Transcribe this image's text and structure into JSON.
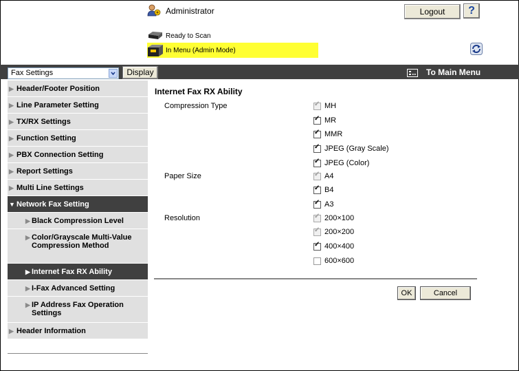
{
  "header": {
    "user": "Administrator",
    "logout_label": "Logout",
    "help_label": "?",
    "status_ready": "Ready to Scan",
    "status_mode": "In Menu (Admin Mode)"
  },
  "toolbar": {
    "category_select": "Fax Settings",
    "display_label": "Display",
    "to_main_menu": "To Main Menu"
  },
  "sidebar": {
    "items": [
      {
        "label": "Header/Footer Position"
      },
      {
        "label": "Line Parameter Setting"
      },
      {
        "label": "TX/RX Settings"
      },
      {
        "label": "Function Setting"
      },
      {
        "label": "PBX Connection Setting"
      },
      {
        "label": "Report Settings"
      },
      {
        "label": "Multi Line Settings"
      },
      {
        "label": "Network Fax Setting",
        "expanded": true
      },
      {
        "label": "Black Compression Level",
        "sub": true
      },
      {
        "label": "Color/Grayscale Multi-Value Compression Method",
        "sub": true
      },
      {
        "label": "Internet Fax RX Ability",
        "sub": true,
        "active": true
      },
      {
        "label": "I-Fax Advanced Setting",
        "sub": true
      },
      {
        "label": "IP Address Fax Operation Settings",
        "sub": true
      },
      {
        "label": "Header Information"
      }
    ]
  },
  "main": {
    "title": "Internet Fax RX Ability",
    "groups": [
      {
        "label": "Compression Type",
        "options": [
          {
            "label": "MH",
            "checked": true,
            "disabled": true
          },
          {
            "label": "MR",
            "checked": true,
            "disabled": false
          },
          {
            "label": "MMR",
            "checked": true,
            "disabled": false
          },
          {
            "label": "JPEG (Gray Scale)",
            "checked": true,
            "disabled": false
          },
          {
            "label": "JPEG (Color)",
            "checked": true,
            "disabled": false
          }
        ]
      },
      {
        "label": "Paper Size",
        "options": [
          {
            "label": "A4",
            "checked": true,
            "disabled": true
          },
          {
            "label": "B4",
            "checked": true,
            "disabled": false
          },
          {
            "label": "A3",
            "checked": true,
            "disabled": false
          }
        ]
      },
      {
        "label": "Resolution",
        "options": [
          {
            "label": "200×100",
            "checked": true,
            "disabled": true
          },
          {
            "label": "200×200",
            "checked": true,
            "disabled": true
          },
          {
            "label": "400×400",
            "checked": true,
            "disabled": false
          },
          {
            "label": "600×600",
            "checked": false,
            "disabled": false
          }
        ]
      }
    ],
    "ok_label": "OK",
    "cancel_label": "Cancel"
  },
  "colors": {
    "dark_bar": "#404040",
    "status_highlight": "#ffff33",
    "nav_bg": "#e0e0e0"
  }
}
